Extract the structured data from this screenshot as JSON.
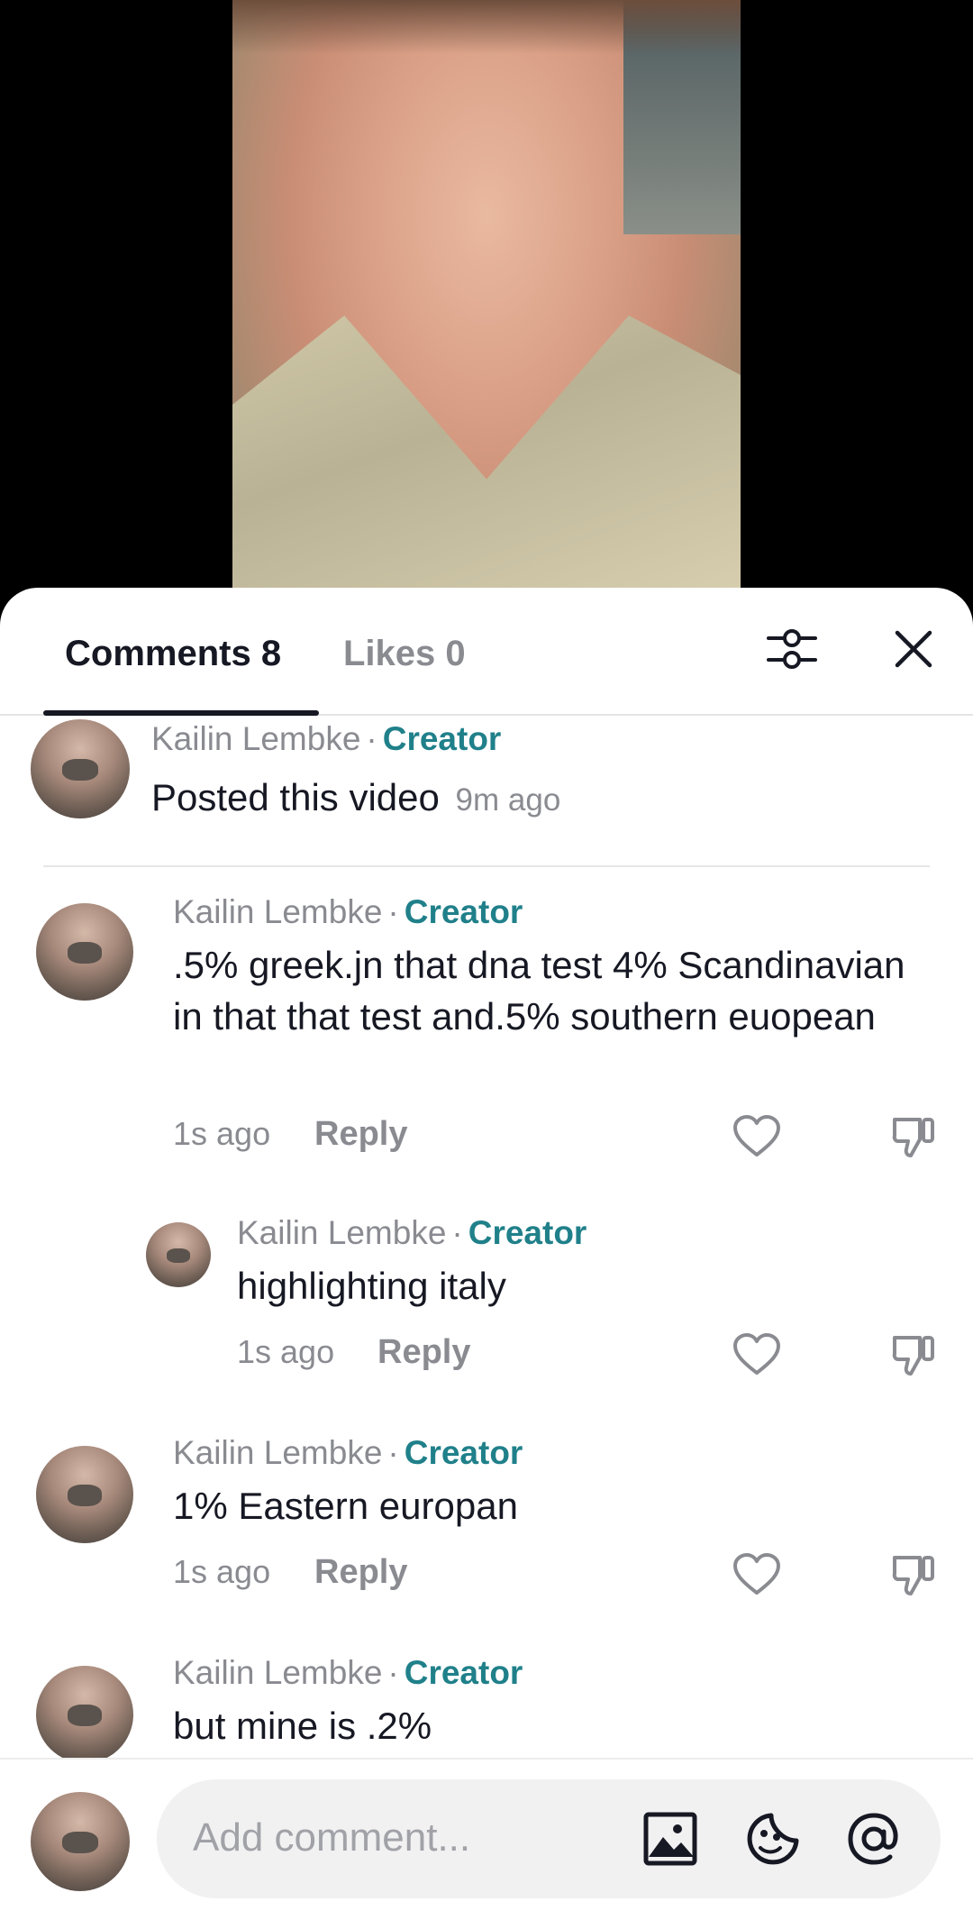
{
  "tabs": {
    "comments_label": "Comments 8",
    "likes_label": "Likes 0"
  },
  "icons": {
    "filter": "sliders-icon",
    "close": "close-icon",
    "like": "heart-icon",
    "dislike": "thumbs-down-icon",
    "image": "image-icon",
    "sticker": "emoji-sticker-icon",
    "mention": "at-mention-icon"
  },
  "pinned": {
    "author": "Kailin Lembke",
    "separator": "·",
    "badge": "Creator",
    "text": "Posted this video",
    "time": "9m ago"
  },
  "comments": [
    {
      "author": "Kailin Lembke",
      "separator": "·",
      "badge": "Creator",
      "text": ".5% greek.jn that dna test 4% Scandinavian in that that test and.5% southern euopean",
      "time": "1s ago",
      "reply": "Reply"
    },
    {
      "author": "Kailin Lembke",
      "separator": "·",
      "badge": "Creator",
      "text": "highlighting italy",
      "time": "1s ago",
      "reply": "Reply"
    },
    {
      "author": "Kailin Lembke",
      "separator": "·",
      "badge": "Creator",
      "text": "1% Eastern europan",
      "time": "1s ago",
      "reply": "Reply"
    },
    {
      "author": "Kailin Lembke",
      "separator": "·",
      "badge": "Creator",
      "text": "but mine is .2%"
    }
  ],
  "composer": {
    "placeholder": "Add comment..."
  },
  "colors": {
    "creator_accent": "#20808a",
    "text_primary": "#161823",
    "text_secondary": "#8a8b91"
  }
}
